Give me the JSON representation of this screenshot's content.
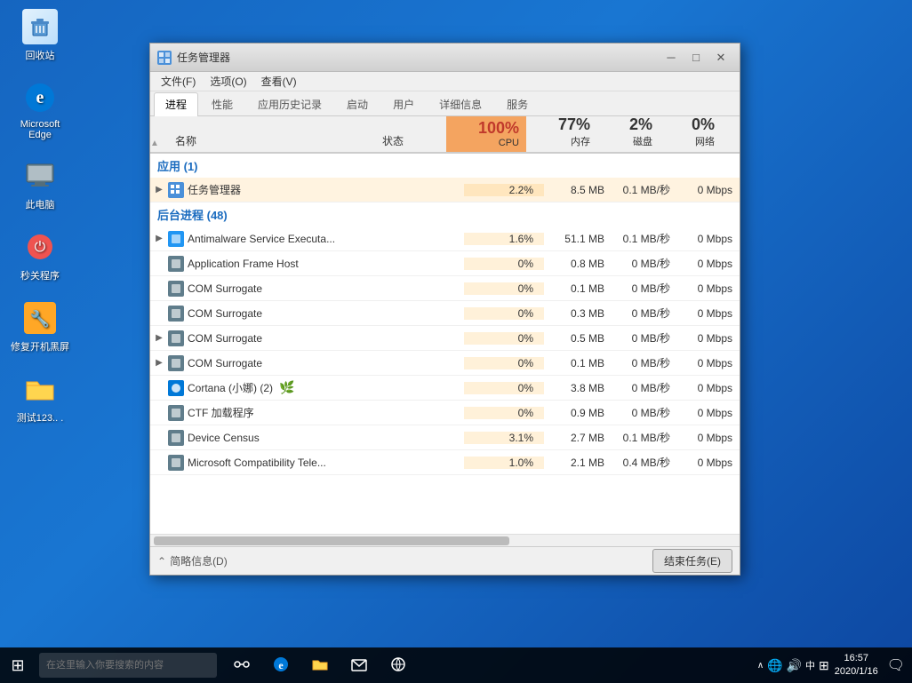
{
  "desktop": {
    "icons": [
      {
        "id": "recycle-bin",
        "label": "回收站",
        "color": "#5b9bd5"
      },
      {
        "id": "microsoft-edge",
        "label": "Microsoft Edge",
        "color": "#0078d7"
      },
      {
        "id": "this-computer",
        "label": "此电脑",
        "color": "#78909c"
      },
      {
        "id": "shutdown",
        "label": "秒关程序",
        "color": "#ef5350"
      },
      {
        "id": "repair",
        "label": "修复开机黑屏",
        "color": "#ffa726"
      },
      {
        "id": "folder",
        "label": "测试123.. .",
        "color": "#ffd54f"
      }
    ]
  },
  "taskbar": {
    "search_placeholder": "在这里输入你要搜索的内容",
    "time": "16:57",
    "date": "2020/1/16",
    "language": "中",
    "apps": [
      "⊞",
      "⊙",
      "◎",
      "📁",
      "✉",
      "🌐"
    ]
  },
  "window": {
    "title": "任务管理器",
    "menu_items": [
      "文件(F)",
      "选项(O)",
      "查看(V)"
    ],
    "tabs": [
      {
        "id": "process",
        "label": "进程",
        "active": true
      },
      {
        "id": "performance",
        "label": "性能",
        "active": false
      },
      {
        "id": "app-history",
        "label": "应用历史记录",
        "active": false
      },
      {
        "id": "startup",
        "label": "启动",
        "active": false
      },
      {
        "id": "users",
        "label": "用户",
        "active": false
      },
      {
        "id": "details",
        "label": "详细信息",
        "active": false
      },
      {
        "id": "services",
        "label": "服务",
        "active": false
      }
    ],
    "columns": {
      "name": "名称",
      "status": "状态",
      "cpu": {
        "pct": "100%",
        "label": "CPU"
      },
      "mem": {
        "pct": "77%",
        "label": "内存"
      },
      "disk": {
        "pct": "2%",
        "label": "磁盘"
      },
      "net": {
        "pct": "0%",
        "label": "网络"
      }
    },
    "sections": [
      {
        "id": "apps",
        "label": "应用 (1)",
        "rows": [
          {
            "expandable": true,
            "name": "任务管理器",
            "status": "",
            "cpu": "2.2%",
            "mem": "8.5 MB",
            "disk": "0.1 MB/秒",
            "net": "0 Mbps",
            "highlighted": true
          }
        ]
      },
      {
        "id": "background",
        "label": "后台进程 (48)",
        "rows": [
          {
            "expandable": true,
            "name": "Antimalware Service Executa...",
            "status": "",
            "cpu": "1.6%",
            "mem": "51.1 MB",
            "disk": "0.1 MB/秒",
            "net": "0 Mbps",
            "highlighted": false
          },
          {
            "expandable": false,
            "name": "Application Frame Host",
            "status": "",
            "cpu": "0%",
            "mem": "0.8 MB",
            "disk": "0 MB/秒",
            "net": "0 Mbps",
            "highlighted": false
          },
          {
            "expandable": false,
            "name": "COM Surrogate",
            "status": "",
            "cpu": "0%",
            "mem": "0.1 MB",
            "disk": "0 MB/秒",
            "net": "0 Mbps",
            "highlighted": false
          },
          {
            "expandable": false,
            "name": "COM Surrogate",
            "status": "",
            "cpu": "0%",
            "mem": "0.3 MB",
            "disk": "0 MB/秒",
            "net": "0 Mbps",
            "highlighted": false
          },
          {
            "expandable": true,
            "name": "COM Surrogate",
            "status": "",
            "cpu": "0%",
            "mem": "0.5 MB",
            "disk": "0 MB/秒",
            "net": "0 Mbps",
            "highlighted": false
          },
          {
            "expandable": true,
            "name": "COM Surrogate",
            "status": "",
            "cpu": "0%",
            "mem": "0.1 MB",
            "disk": "0 MB/秒",
            "net": "0 Mbps",
            "highlighted": false
          },
          {
            "expandable": false,
            "name": "Cortana (小娜) (2)",
            "status": "",
            "cpu": "0%",
            "mem": "3.8 MB",
            "disk": "0 MB/秒",
            "net": "0 Mbps",
            "highlighted": false,
            "special": "cortana"
          },
          {
            "expandable": false,
            "name": "CTF 加载程序",
            "status": "",
            "cpu": "0%",
            "mem": "0.9 MB",
            "disk": "0 MB/秒",
            "net": "0 Mbps",
            "highlighted": false
          },
          {
            "expandable": false,
            "name": "Device Census",
            "status": "",
            "cpu": "3.1%",
            "mem": "2.7 MB",
            "disk": "0.1 MB/秒",
            "net": "0 Mbps",
            "highlighted": false
          },
          {
            "expandable": false,
            "name": "Microsoft Compatibility Tele...",
            "status": "",
            "cpu": "1.0%",
            "mem": "2.1 MB",
            "disk": "0.4 MB/秒",
            "net": "0 Mbps",
            "highlighted": false
          }
        ]
      }
    ],
    "statusbar": {
      "summary_label": "简略信息(D)",
      "end_task_label": "结束任务(E)"
    }
  }
}
